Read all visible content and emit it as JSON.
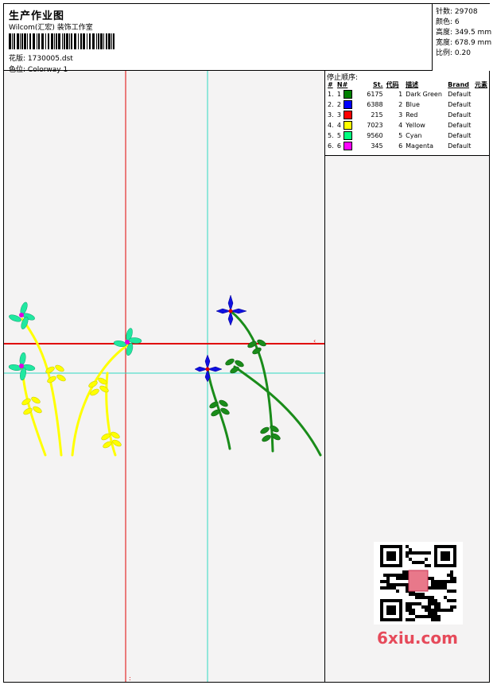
{
  "header": {
    "title": "生产作业图",
    "company": "Wilcom(汇宏) 装饰工作室",
    "pattern_label": "花版:",
    "pattern_value": "1730005.dst",
    "colorway_label": "色位:",
    "colorway_value": "Colorway 1"
  },
  "stats": {
    "stitches_label": "针数:",
    "stitches_value": "29708",
    "colors_label": "颜色:",
    "colors_value": "6",
    "height_label": "高度:",
    "height_value": "349.5 mm",
    "width_label": "宽度:",
    "width_value": "678.9 mm",
    "scale_label": "比例:",
    "scale_value": "0.20"
  },
  "stop_sequence": {
    "title": "停止顺序:",
    "columns": [
      "#",
      "N#",
      "St.",
      "代码",
      "描述",
      "Brand",
      "元素"
    ],
    "rows": [
      {
        "idx": "1.",
        "n": "1",
        "color": "#008000",
        "st": "6175",
        "code": "1",
        "desc": "Dark Green",
        "brand": "Default"
      },
      {
        "idx": "2.",
        "n": "2",
        "color": "#0000ff",
        "st": "6388",
        "code": "2",
        "desc": "Blue",
        "brand": "Default"
      },
      {
        "idx": "3.",
        "n": "3",
        "color": "#ff0000",
        "st": "215",
        "code": "3",
        "desc": "Red",
        "brand": "Default"
      },
      {
        "idx": "4.",
        "n": "4",
        "color": "#ffff00",
        "st": "7023",
        "code": "4",
        "desc": "Yellow",
        "brand": "Default"
      },
      {
        "idx": "5.",
        "n": "5",
        "color": "#00ff80",
        "st": "9560",
        "code": "5",
        "desc": "Cyan",
        "brand": "Default"
      },
      {
        "idx": "6.",
        "n": "6",
        "color": "#ff00ff",
        "st": "345",
        "code": "6",
        "desc": "Magenta",
        "brand": "Default"
      }
    ]
  },
  "watermark": {
    "text": "6xiu.com"
  },
  "colors": {
    "guide_red": "#e00000",
    "guide_cyan": "#30d8c0",
    "green": "#1a8c1a",
    "blue": "#1010e0",
    "yellow": "#ffff00",
    "cyan": "#20e8a0",
    "magenta": "#e000e0"
  }
}
